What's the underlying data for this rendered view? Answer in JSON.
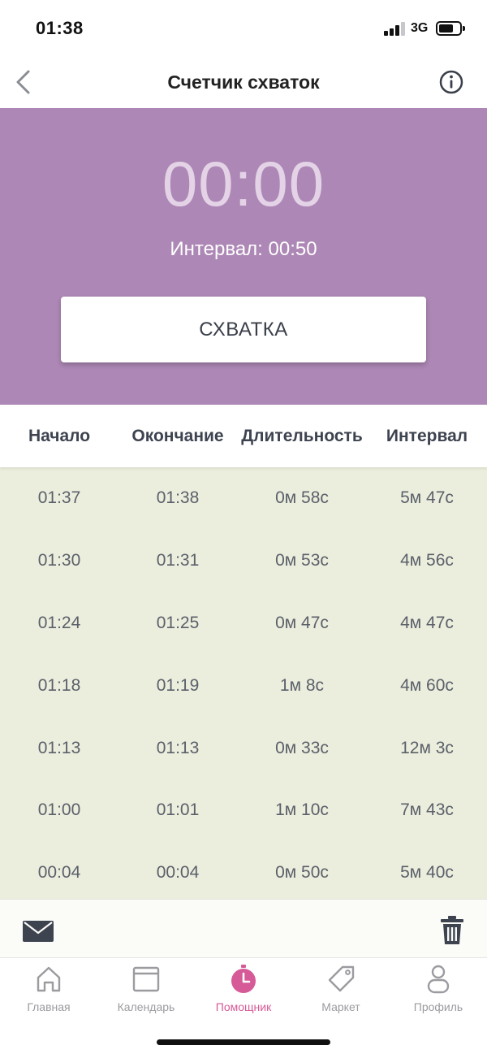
{
  "status_bar": {
    "time": "01:38",
    "network": "3G"
  },
  "nav": {
    "title": "Счетчик схваток"
  },
  "timer": {
    "display": "00:00",
    "interval_label": "Интервал: 00:50"
  },
  "main_button": {
    "label": "СХВАТКА"
  },
  "table": {
    "headers": [
      "Начало",
      "Окончание",
      "Длительность",
      "Интервал"
    ],
    "rows": [
      [
        "01:37",
        "01:38",
        "0м 58с",
        "5м 47с"
      ],
      [
        "01:30",
        "01:31",
        "0м 53с",
        "4м 56с"
      ],
      [
        "01:24",
        "01:25",
        "0м 47с",
        "4м 47с"
      ],
      [
        "01:18",
        "01:19",
        "1м 8с",
        "4м 60с"
      ],
      [
        "01:13",
        "01:13",
        "0м 33с",
        "12м 3с"
      ],
      [
        "01:00",
        "01:01",
        "1м 10с",
        "7м 43с"
      ],
      [
        "00:04",
        "00:04",
        "0м 50с",
        "5м 40с"
      ]
    ]
  },
  "tabs": [
    {
      "label": "Главная",
      "icon": "home-icon"
    },
    {
      "label": "Календарь",
      "icon": "calendar-icon"
    },
    {
      "label": "Помощник",
      "icon": "timer-icon",
      "active": true
    },
    {
      "label": "Маркет",
      "icon": "tag-icon"
    },
    {
      "label": "Профиль",
      "icon": "profile-icon"
    }
  ],
  "colors": {
    "hero": "#ad87b5",
    "table_bg": "#ebeedd",
    "accent": "#d65a97",
    "timer_text": "#e4d3e7"
  }
}
